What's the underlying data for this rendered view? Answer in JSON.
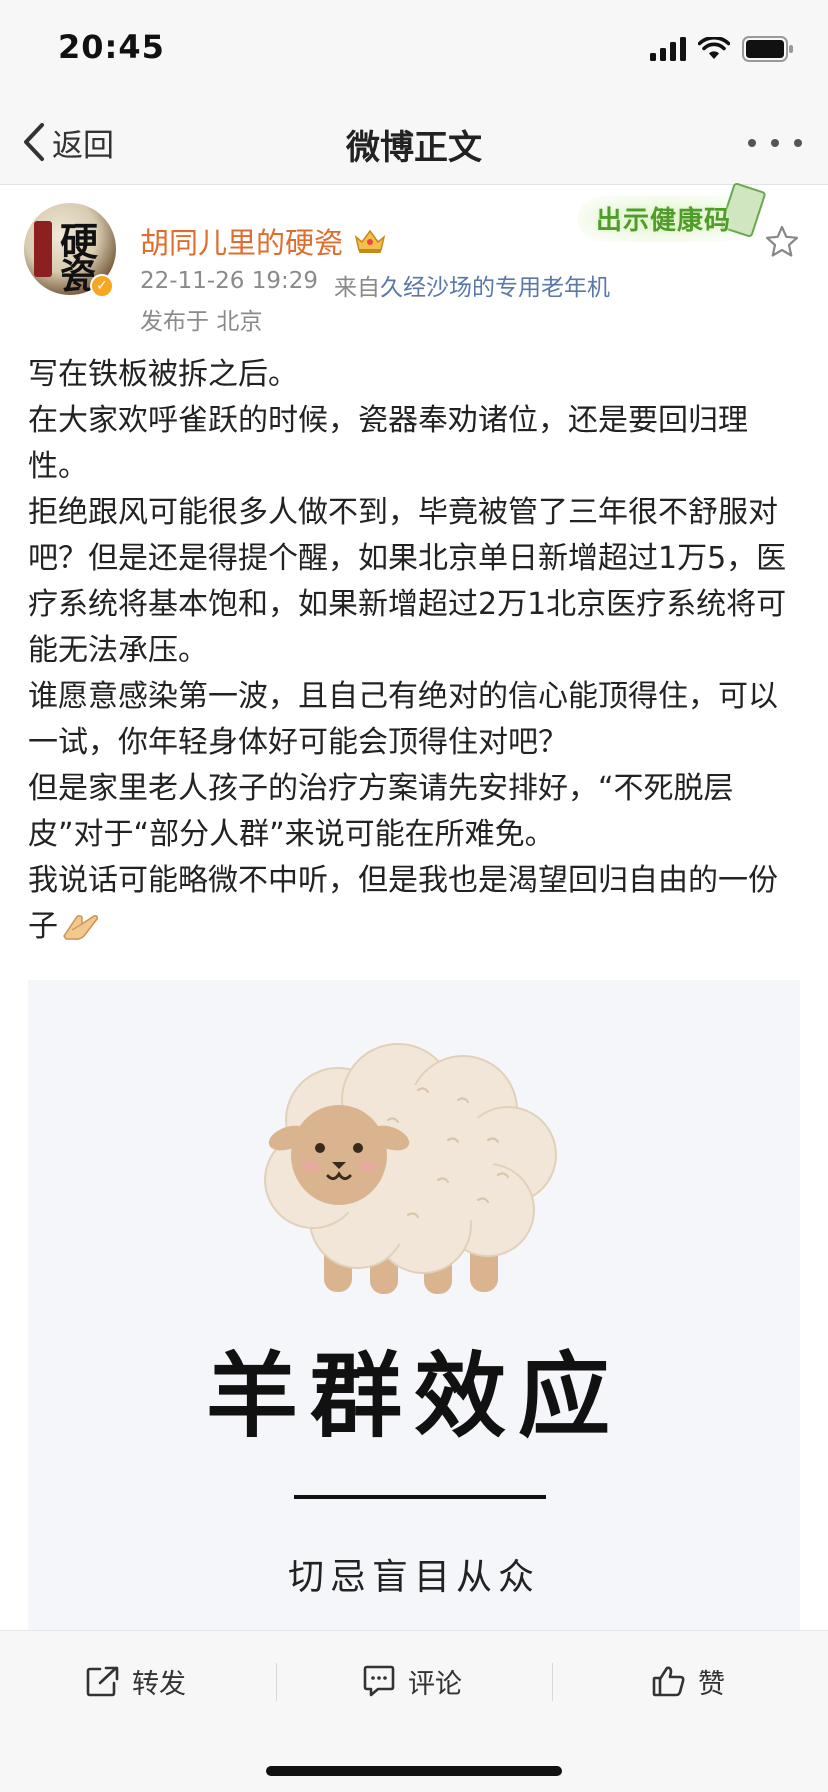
{
  "status_bar": {
    "time": "20:45",
    "icons": [
      "signal-icon",
      "wifi-icon",
      "battery-icon"
    ]
  },
  "nav": {
    "back_label": "返回",
    "title": "微博正文",
    "more_icon": "more-dots-icon"
  },
  "post": {
    "author": {
      "avatar_text": [
        "硬",
        "瓷"
      ],
      "name": "胡同儿里的硬瓷",
      "vip_icon": "crown-icon",
      "verified_icon": "verified-badge-icon"
    },
    "timestamp": "22-11-26 19:29",
    "source_prefix": "来自",
    "source": "久经沙场的专用老年机",
    "location_prefix": "发布于",
    "location": "北京",
    "badge_text": "出示健康码",
    "favorite_icon": "star-icon",
    "paragraphs": [
      "写在铁板被拆之后。",
      "在大家欢呼雀跃的时候，瓷器奉劝诸位，还是要回归理性。",
      "拒绝跟风可能很多人做不到，毕竟被管了三年很不舒服对吧？但是还是得提个醒，如果北京单日新增超过1万5，医疗系统将基本饱和，如果新增超过2万1北京医疗系统将可能无法承压。",
      "谁愿意感染第一波，且自己有绝对的信心能顶得住，可以一试，你年轻身体好可能会顶得住对吧？",
      "但是家里老人孩子的治疗方案请先安排好，“不死脱层皮”对于“部分人群”来说可能在所难免。",
      "我说话可能略微不中听，但是我也是渴望回归自由的一份子"
    ],
    "image": {
      "title": "羊群效应",
      "subtitle": "切忌盲目从众"
    }
  },
  "actions": {
    "repost_label": "转发",
    "comment_label": "评论",
    "like_label": "赞"
  },
  "colors": {
    "username": "#e06d2e",
    "source_link": "#5a78a8",
    "meta_text": "#8a8a8a",
    "bar_bg": "#f7f7f7"
  }
}
